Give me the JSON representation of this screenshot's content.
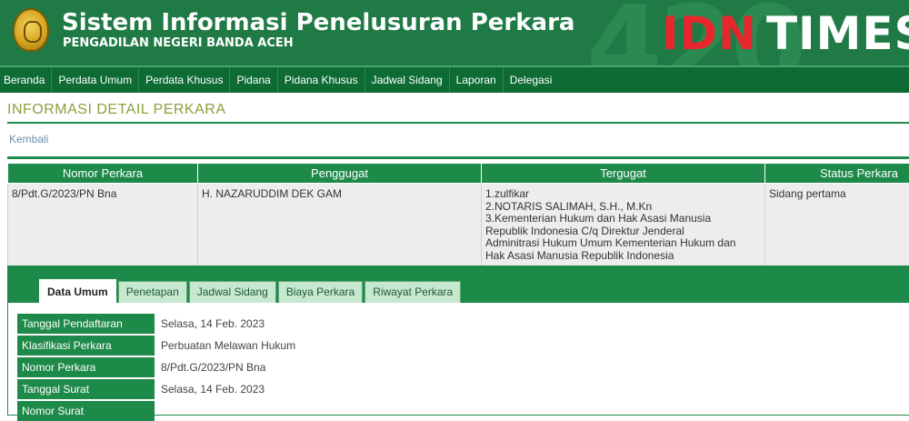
{
  "header": {
    "title": "Sistem Informasi Penelusuran Perkara",
    "subtitle": "PENGADILAN NEGERI BANDA ACEH",
    "brand_idn": "IDN",
    "brand_times": "TIMES",
    "bg_number": "420"
  },
  "nav": {
    "items": [
      "Beranda",
      "Perdata Umum",
      "Perdata Khusus",
      "Pidana",
      "Pidana Khusus",
      "Jadwal Sidang",
      "Laporan",
      "Delegasi"
    ]
  },
  "page": {
    "title": "INFORMASI DETAIL PERKARA",
    "back_label": "Kembali"
  },
  "case_table": {
    "headers": [
      "Nomor Perkara",
      "Penggugat",
      "Tergugat",
      "Status Perkara"
    ],
    "row": {
      "nomor": "8/Pdt.G/2023/PN Bna",
      "penggugat": "H. NAZARUDDIM DEK GAM",
      "tergugat": [
        "1.zulfikar",
        "2.NOTARIS SALIMAH, S.H., M.Kn",
        "3.Kementerian Hukum dan Hak Asasi Manusia",
        "Republik Indonesia C/q Direktur Jenderal",
        "Adminitrasi Hukum Umum Kementerian Hukum dan",
        "Hak Asasi Manusia Republik Indonesia"
      ],
      "status": "Sidang pertama"
    }
  },
  "tabs": [
    "Data Umum",
    "Penetapan",
    "Jadwal Sidang",
    "Biaya Perkara",
    "Riwayat Perkara"
  ],
  "data_umum": [
    {
      "label": "Tanggal Pendaftaran",
      "value": "Selasa, 14 Feb. 2023"
    },
    {
      "label": "Klasifikasi Perkara",
      "value": "Perbuatan Melawan Hukum"
    },
    {
      "label": "Nomor Perkara",
      "value": "8/Pdt.G/2023/PN Bna"
    },
    {
      "label": "Tanggal Surat",
      "value": "Selasa, 14 Feb. 2023"
    },
    {
      "label": "Nomor Surat",
      "value": ""
    }
  ],
  "colors": {
    "header_green": "#1f7a45",
    "nav_green": "#0d6b33",
    "table_header_green": "#1e8a49",
    "title_olive": "#8aa13c",
    "brand_red": "#e8262e"
  }
}
